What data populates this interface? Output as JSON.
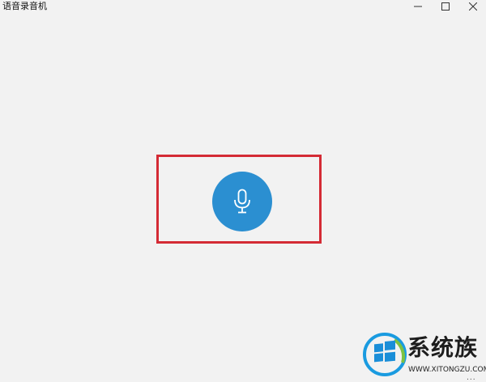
{
  "window": {
    "title": "语音录音机",
    "minimize_icon": "minimize-icon",
    "maximize_icon": "maximize-icon",
    "close_icon": "close-icon"
  },
  "main": {
    "record_button_icon": "microphone-icon",
    "record_button_color": "#2b8fd1",
    "highlight_color": "#d42b35"
  },
  "watermark": {
    "brand": "系统族",
    "url": "WWW.XITONGZU.COM",
    "logo_icon": "windows-logo-icon"
  },
  "more_label": "..."
}
